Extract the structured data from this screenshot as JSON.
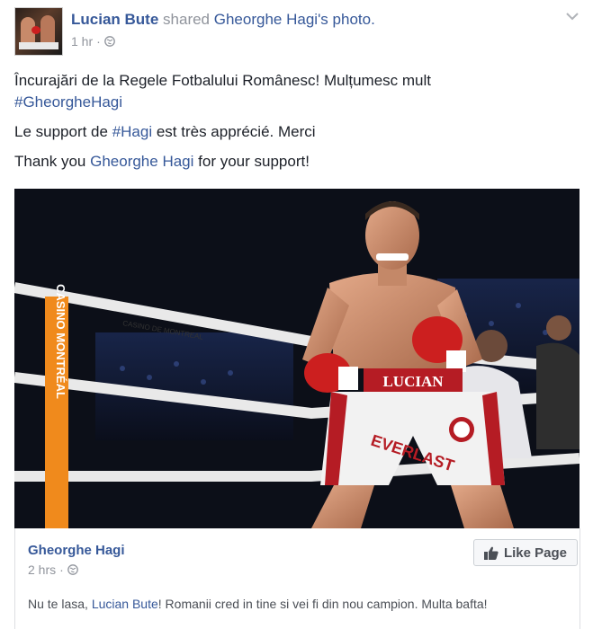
{
  "header": {
    "author": "Lucian Bute",
    "action": "shared",
    "source_owner": "Gheorghe Hagi",
    "source_suffix": "'s photo.",
    "time": "1 hr",
    "separator": "·",
    "privacy_icon": "globe-icon",
    "menu_icon": "chevron-down-icon"
  },
  "post": {
    "line1": "Încurajări de la Regele Fotbalului Românesc! Mulțumesc mult",
    "line1_hashtag": "#GheorgheHagi",
    "line2_before": "Le support de ",
    "line2_hashtag": "#Hagi",
    "line2_after": " est très apprécié. Merci",
    "line3_before": "Thank you ",
    "line3_link": "Gheorghe Hagi",
    "line3_after": " for your support!"
  },
  "photo": {
    "waistband_text": "LUCIAN",
    "shorts_brand": "EVERLAST",
    "corner_pad_text": "CASINO MONTRÉAL",
    "rope_text": "CASINO DE MONTREAL"
  },
  "shared": {
    "name": "Gheorghe Hagi",
    "time": "2 hrs",
    "separator": "·",
    "like_label": "Like Page",
    "body_before": "Nu te lasa, ",
    "body_link": "Lucian Bute",
    "body_after": "! Romanii cred in tine si vei fi din nou campion. Multa bafta!"
  },
  "colors": {
    "link": "#365899",
    "muted": "#90949c",
    "text": "#1d2129"
  }
}
